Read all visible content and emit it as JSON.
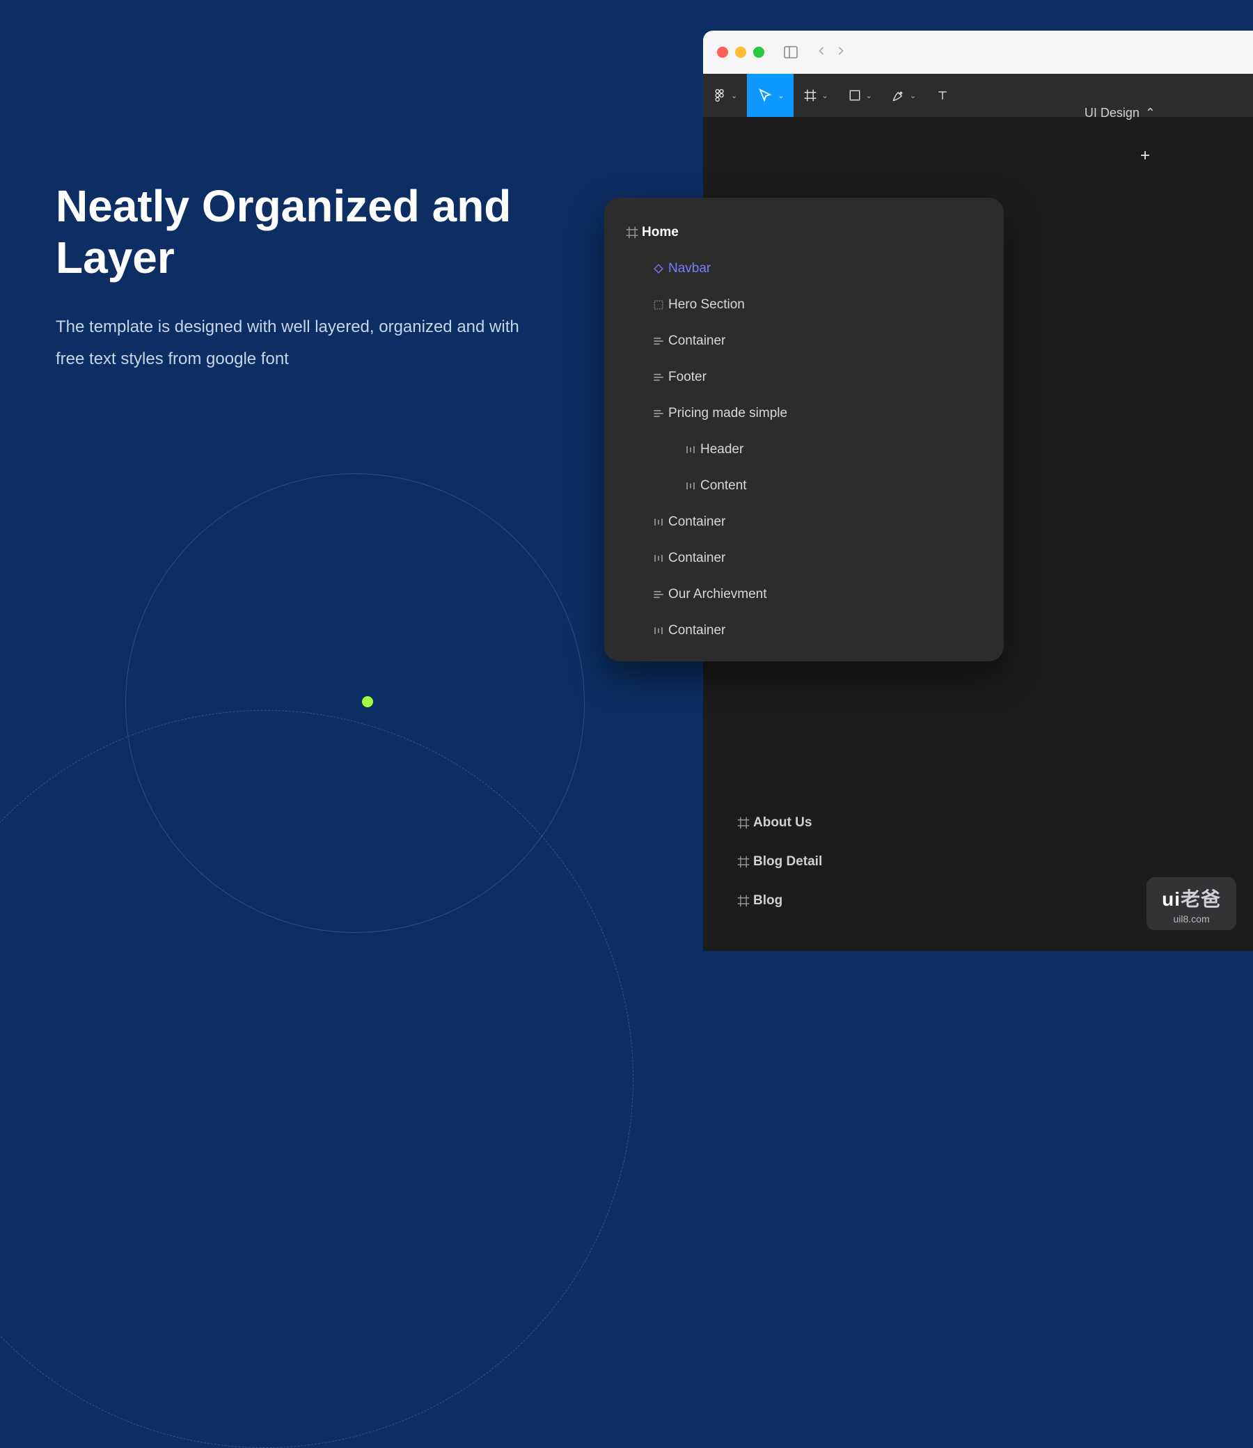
{
  "promo": {
    "heading": "Neatly Organized and Layer",
    "body": "The template is designed with well layered, organized and with free text styles from google font"
  },
  "browser": {
    "traffic": [
      "close",
      "minimize",
      "maximize"
    ]
  },
  "toolbar": {
    "items": [
      "figma",
      "move",
      "frame",
      "rectangle",
      "pen",
      "text"
    ]
  },
  "panel": {
    "title": "UI Design",
    "plus": "+"
  },
  "layers": {
    "frame": "Home",
    "items": [
      {
        "label": "Navbar",
        "icon": "component",
        "indent": 1,
        "selected": true
      },
      {
        "label": "Hero Section",
        "icon": "selection",
        "indent": 1
      },
      {
        "label": "Container",
        "icon": "align-left",
        "indent": 1
      },
      {
        "label": "Footer",
        "icon": "align-left",
        "indent": 1
      },
      {
        "label": "Pricing made simple",
        "icon": "align-left",
        "indent": 1
      },
      {
        "label": "Header",
        "icon": "autolayout-h",
        "indent": 2
      },
      {
        "label": "Content",
        "icon": "autolayout-h",
        "indent": 2
      },
      {
        "label": "Container",
        "icon": "autolayout-h",
        "indent": 1
      },
      {
        "label": "Container",
        "icon": "autolayout-h",
        "indent": 1
      },
      {
        "label": "Our Archievment",
        "icon": "align-left",
        "indent": 1
      },
      {
        "label": "Container",
        "icon": "autolayout-h",
        "indent": 1
      }
    ]
  },
  "extraLayers": [
    {
      "label": "About Us"
    },
    {
      "label": "Blog Detail"
    },
    {
      "label": "Blog"
    }
  ],
  "watermark": {
    "brand_prefix": "ui",
    "brand_suffix": "老爸",
    "url": "uil8.com"
  }
}
